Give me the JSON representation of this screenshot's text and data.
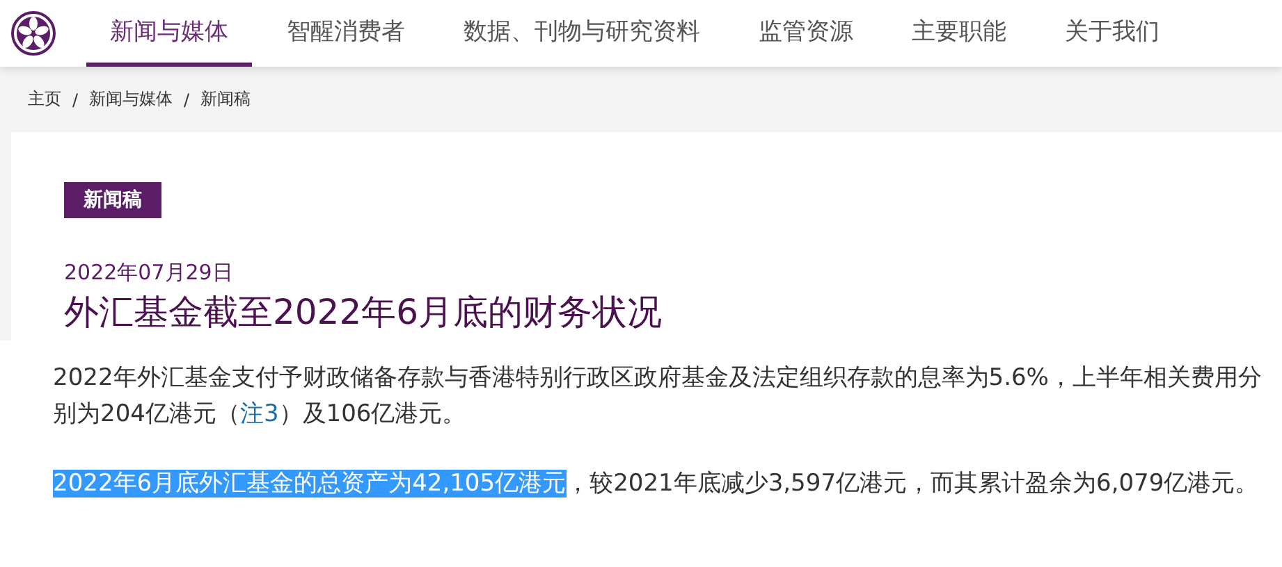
{
  "nav": {
    "tabs": [
      {
        "label": "新闻与媒体",
        "selected": true
      },
      {
        "label": "智醒消费者",
        "selected": false
      },
      {
        "label": "数据、刊物与研究资料",
        "selected": false
      },
      {
        "label": "监管资源",
        "selected": false
      },
      {
        "label": "主要职能",
        "selected": false
      },
      {
        "label": "关于我们",
        "selected": false
      }
    ]
  },
  "breadcrumb": {
    "separator": "/",
    "items": [
      "主页",
      "新闻与媒体",
      "新闻稿"
    ]
  },
  "article": {
    "tag": "新闻稿",
    "date": "2022年07月29日",
    "title": "外汇基金截至2022年6月底的财务状况",
    "paragraphs": [
      [
        {
          "kind": "text",
          "text": "2022年外汇基金支付予财政储备存款与香港特别行政区政府基金及法定组织存款的息率为5.6%，上半年相关费用分别为204亿港元（"
        },
        {
          "kind": "link",
          "text": "注3"
        },
        {
          "kind": "text",
          "text": "）及106亿港元。"
        }
      ],
      [
        {
          "kind": "text",
          "text": "2022年6月底外汇基金的总资产为42,105亿港元",
          "highlighted": true
        },
        {
          "kind": "text",
          "text": "，较2021年底减少3,597亿港元，而其累计盈余为6,079亿港元。",
          "highlighted": false
        }
      ]
    ]
  }
}
